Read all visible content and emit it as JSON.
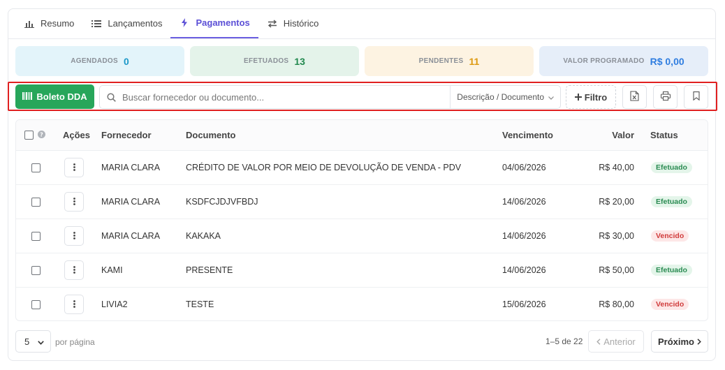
{
  "tabs": [
    {
      "label": "Resumo",
      "icon": "bar-chart-icon"
    },
    {
      "label": "Lançamentos",
      "icon": "list-icon"
    },
    {
      "label": "Pagamentos",
      "icon": "bolt-icon",
      "active": true
    },
    {
      "label": "Histórico",
      "icon": "swap-icon"
    }
  ],
  "stats": {
    "scheduled": {
      "label": "AGENDADOS",
      "value": "0"
    },
    "done": {
      "label": "EFETUADOS",
      "value": "13"
    },
    "pending": {
      "label": "PENDENTES",
      "value": "11"
    },
    "amount": {
      "label": "VALOR PROGRAMADO",
      "value": "R$ 0,00"
    }
  },
  "colors": {
    "accent": "#6a5ee0",
    "green": "#27a65a",
    "highlight": "#e02020"
  },
  "toolbar": {
    "boleto_label": "Boleto DDA",
    "search_placeholder": "Buscar fornecedor ou documento...",
    "search_scope": "Descrição / Documento",
    "filter_label": "Filtro"
  },
  "table": {
    "headers": {
      "actions": "Ações",
      "supplier": "Fornecedor",
      "document": "Documento",
      "due": "Vencimento",
      "value": "Valor",
      "status": "Status"
    },
    "rows": [
      {
        "supplier": "MARIA CLARA",
        "document": "CRÉDITO DE VALOR POR MEIO DE DEVOLUÇÃO DE VENDA - PDV",
        "due": "04/06/2026",
        "value": "R$ 40,00",
        "status": "Efetuado",
        "state": "ok"
      },
      {
        "supplier": "MARIA CLARA",
        "document": "KSDFCJDJVFBDJ",
        "due": "14/06/2026",
        "value": "R$ 20,00",
        "status": "Efetuado",
        "state": "ok"
      },
      {
        "supplier": "MARIA CLARA",
        "document": "KAKAKA",
        "due": "14/06/2026",
        "value": "R$ 30,00",
        "status": "Vencido",
        "state": "late"
      },
      {
        "supplier": "KAMI",
        "document": "PRESENTE",
        "due": "14/06/2026",
        "value": "R$ 50,00",
        "status": "Efetuado",
        "state": "ok"
      },
      {
        "supplier": "LIVIA2",
        "document": "TESTE",
        "due": "15/06/2026",
        "value": "R$ 80,00",
        "status": "Vencido",
        "state": "late"
      }
    ]
  },
  "pagination": {
    "per_page": "5",
    "per_page_label": "por página",
    "range": "1–5 de 22",
    "prev": "Anterior",
    "next": "Próximo"
  }
}
